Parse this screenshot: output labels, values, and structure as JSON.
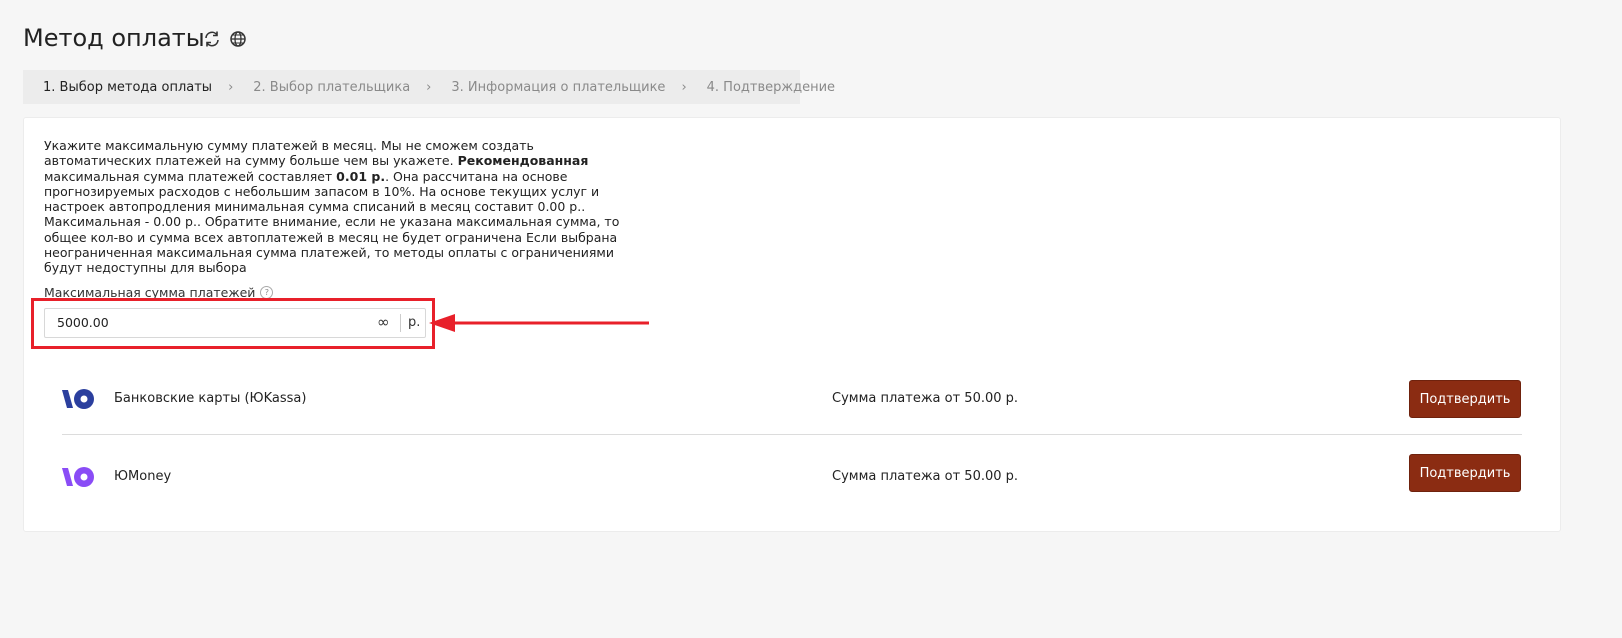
{
  "page": {
    "title": "Метод оплаты"
  },
  "icons": {
    "refresh": "refresh-icon",
    "globe": "globe-icon"
  },
  "steps": [
    {
      "label": "1. Выбор метода оплаты",
      "active": true
    },
    {
      "label": "2. Выбор плательщика",
      "active": false
    },
    {
      "label": "3. Информация о плательщике",
      "active": false
    },
    {
      "label": "4. Подтверждение",
      "active": false
    }
  ],
  "description": {
    "p1": "Укажите максимальную сумму платежей в месяц. Мы не сможем создать автоматических платежей на сумму больше чем вы укажете. ",
    "b1": "Рекомендованная",
    "p2": " максимальная сумма платежей составляет ",
    "b2": "0.01 р.",
    "p3": ". Она рассчитана на основе прогнозируемых расходов с небольшим запасом в 10%. На основе текущих услуг и настроек автопродления минимальная сумма списаний в месяц составит 0.00 р.. Максимальная - 0.00 р.. Обратите внимание, если не указана максимальная сумма, то общее кол-во и сумма всех автоплатежей в месяц не будет ограничена Если выбрана неограниченная максимальная сумма платежей, то методы оплаты с ограничениями будут недоступны для выбора"
  },
  "max_amount": {
    "label": "Максимальная сумма платежей",
    "help": "?",
    "value": "5000.00",
    "infinity": "∞",
    "currency": "р."
  },
  "methods": [
    {
      "name": "Банковские карты (ЮKassa)",
      "min": "Сумма платежа от 50.00 р.",
      "button": "Подтвердить",
      "logo_color": "#2b3f9e"
    },
    {
      "name": "ЮMoney",
      "min": "Сумма платежа от 50.00 р.",
      "button": "Подтвердить",
      "logo_color": "#8a4cf6"
    }
  ],
  "colors": {
    "accent_button": "#8b2c12",
    "highlight": "#e8202a"
  }
}
